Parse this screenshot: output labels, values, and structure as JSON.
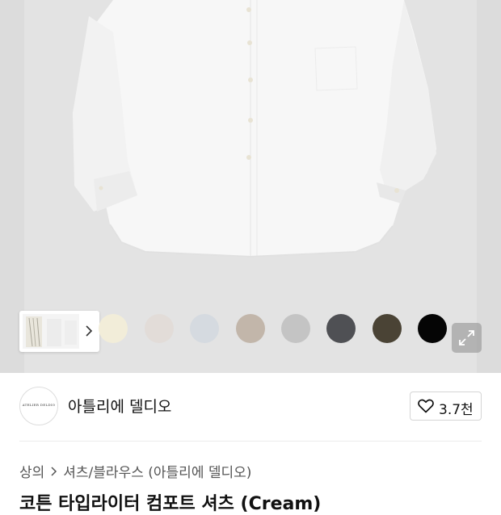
{
  "product": {
    "swatches": [
      {
        "color": "#f2edd9"
      },
      {
        "color": "#e2dcd8"
      },
      {
        "color": "#d5dae0"
      },
      {
        "color": "#c2b6aa"
      },
      {
        "color": "#c4c4c4"
      },
      {
        "color": "#4f5054"
      },
      {
        "color": "#4a4335"
      },
      {
        "color": "#050505"
      }
    ]
  },
  "brand": {
    "logo_text": "ATELIER DELDIO",
    "name": "아틀리에 델디오",
    "like_count": "3.7천"
  },
  "breadcrumb": {
    "items": [
      "상의",
      "셔츠/블라우스",
      "(아틀리에 델디오)"
    ]
  },
  "title": "코튼 타입라이터 컴포트 셔츠 (Cream)"
}
